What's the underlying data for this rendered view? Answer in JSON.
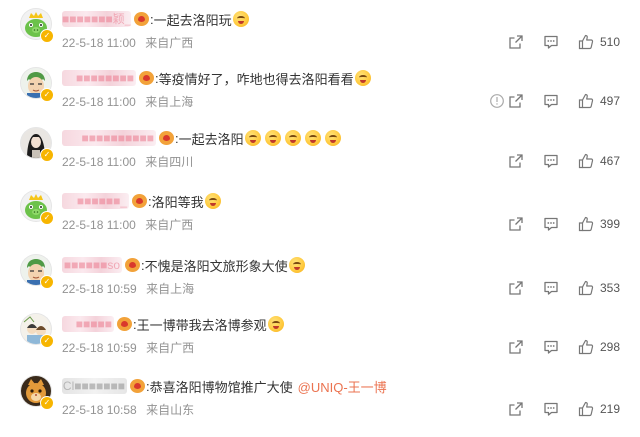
{
  "comments": [
    {
      "avatar": "green-pig-king-avatar",
      "name": "■■■■■■■颖_",
      "name_style": "pink",
      "name_width": 67,
      "text": "一起去洛阳玩",
      "emojis": 1,
      "mention": "",
      "date": "22-5-18 11:00",
      "location": "来自广西",
      "likes": "510"
    },
    {
      "avatar": "zoro-avatar",
      "name": "■■■■■■■■",
      "name_style": "pink",
      "name_width": 72,
      "text": "等疫情好了，咋地也得去洛阳看看",
      "emojis": 1,
      "mention": "",
      "date": "22-5-18 11:00",
      "location": "来自上海",
      "likes": "497"
    },
    {
      "avatar": "girl-portrait-avatar",
      "name": "■■■■■■■■■■",
      "name_style": "pink",
      "name_width": 92,
      "text": "一起去洛阳",
      "emojis": 5,
      "mention": "",
      "date": "22-5-18 11:00",
      "location": "来自四川",
      "likes": "467"
    },
    {
      "avatar": "green-pig-king-avatar",
      "name": "■■■■■■_",
      "name_style": "pink",
      "name_width": 65,
      "text": "洛阳等我",
      "emojis": 1,
      "mention": "",
      "date": "22-5-18 11:00",
      "location": "来自广西",
      "likes": "399"
    },
    {
      "avatar": "zoro-avatar",
      "name": "■■■■■■so",
      "name_style": "pink",
      "name_width": 58,
      "text": "不愧是洛阳文旅形象大使",
      "emojis": 1,
      "mention": "",
      "date": "22-5-18 10:59",
      "location": "来自上海",
      "likes": "353"
    },
    {
      "avatar": "cartoon-couple-avatar",
      "name": "■■■■■",
      "name_style": "pink",
      "name_width": 50,
      "text": "王一博带我去洛博参观",
      "emojis": 1,
      "mention": "",
      "date": "22-5-18 10:59",
      "location": "来自广西",
      "likes": "298"
    },
    {
      "avatar": "orange-cat-avatar",
      "name": "Cl■■■■■■■",
      "name_style": "grey",
      "name_width": 63,
      "text": "恭喜洛阳博物馆推广大使",
      "emojis": 0,
      "mention": "@UNIQ-王一博",
      "date": "22-5-18 10:58",
      "location": "来自山东",
      "likes": "219"
    }
  ],
  "icons": {
    "share": "share-icon",
    "reply": "reply-icon",
    "like": "thumbs-up-icon",
    "report": "report-icon",
    "verified": "v-badge-icon",
    "fan": "fan-badge-icon",
    "emoji": "laughing-emoji-icon"
  },
  "colors": {
    "mention": "#eb7350",
    "meta_text": "#939393",
    "verified_badge": "#f7b500"
  },
  "report_on_row": 1
}
